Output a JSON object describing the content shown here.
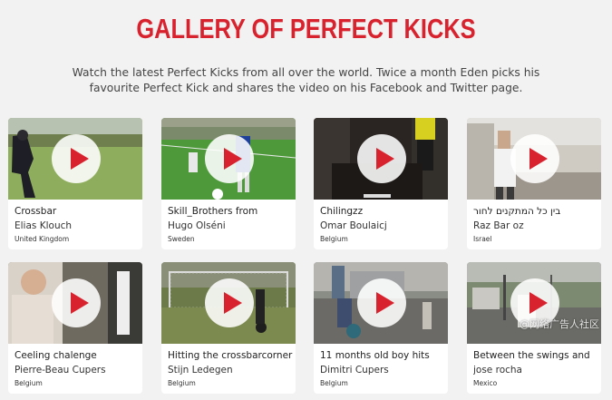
{
  "page": {
    "title": "GALLERY OF PERFECT KICKS",
    "intro": "Watch the latest Perfect Kicks from all over the world. Twice a month Eden picks his favourite Perfect Kick and shares the video on his Facebook and Twitter page.",
    "accent_color": "#d8232f"
  },
  "videos": [
    {
      "title": "Crossbar",
      "name": "Elias Klouch",
      "country": "United Kingdom"
    },
    {
      "title": "Skill_Brothers from",
      "name": "Hugo Olséni",
      "country": "Sweden"
    },
    {
      "title": "Chilingzz",
      "name": "Omar Boulaicj",
      "country": "Belgium"
    },
    {
      "title": "בין כל המתקנים לחור",
      "name": "Raz Bar oz",
      "country": "Israel"
    },
    {
      "title": "Ceeling chalenge",
      "name": "Pierre-Beau Cupers",
      "country": "Belgium"
    },
    {
      "title": "Hitting the crossbarcorner",
      "name": "Stijn Ledegen",
      "country": "Belgium"
    },
    {
      "title": "11 months old boy hits",
      "name": "Dimitri Cupers",
      "country": "Belgium"
    },
    {
      "title": "Between the swings and",
      "name": "jose rocha",
      "country": "Mexico"
    }
  ],
  "watermark": "@网络广告人社区"
}
